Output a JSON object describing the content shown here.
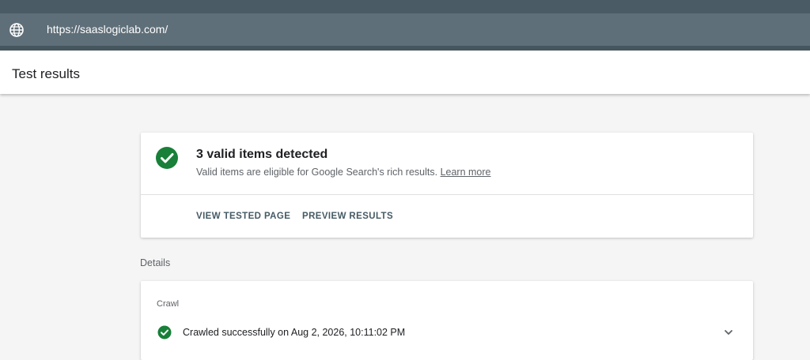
{
  "url_bar": {
    "url": "https://saaslogiclab.com/",
    "icon": "globe-icon"
  },
  "header": {
    "title": "Test results"
  },
  "summary": {
    "icon": "check-circle-icon",
    "heading": "3 valid items detected",
    "description": "Valid items are eligible for Google Search's rich results.",
    "learn_more": "Learn more",
    "actions": {
      "view_tested_page": "VIEW TESTED PAGE",
      "preview_results": "PREVIEW RESULTS"
    }
  },
  "details": {
    "label": "Details",
    "crawl": {
      "label": "Crawl",
      "icon": "check-circle-icon",
      "status": "Crawled successfully on Aug 2, 2026, 10:11:02 PM",
      "expand_icon": "chevron-down-icon"
    }
  },
  "colors": {
    "success": "#188038",
    "url_bar": "#5f6f79",
    "top_strip": "#4a5b66",
    "action_text": "#455a64"
  }
}
